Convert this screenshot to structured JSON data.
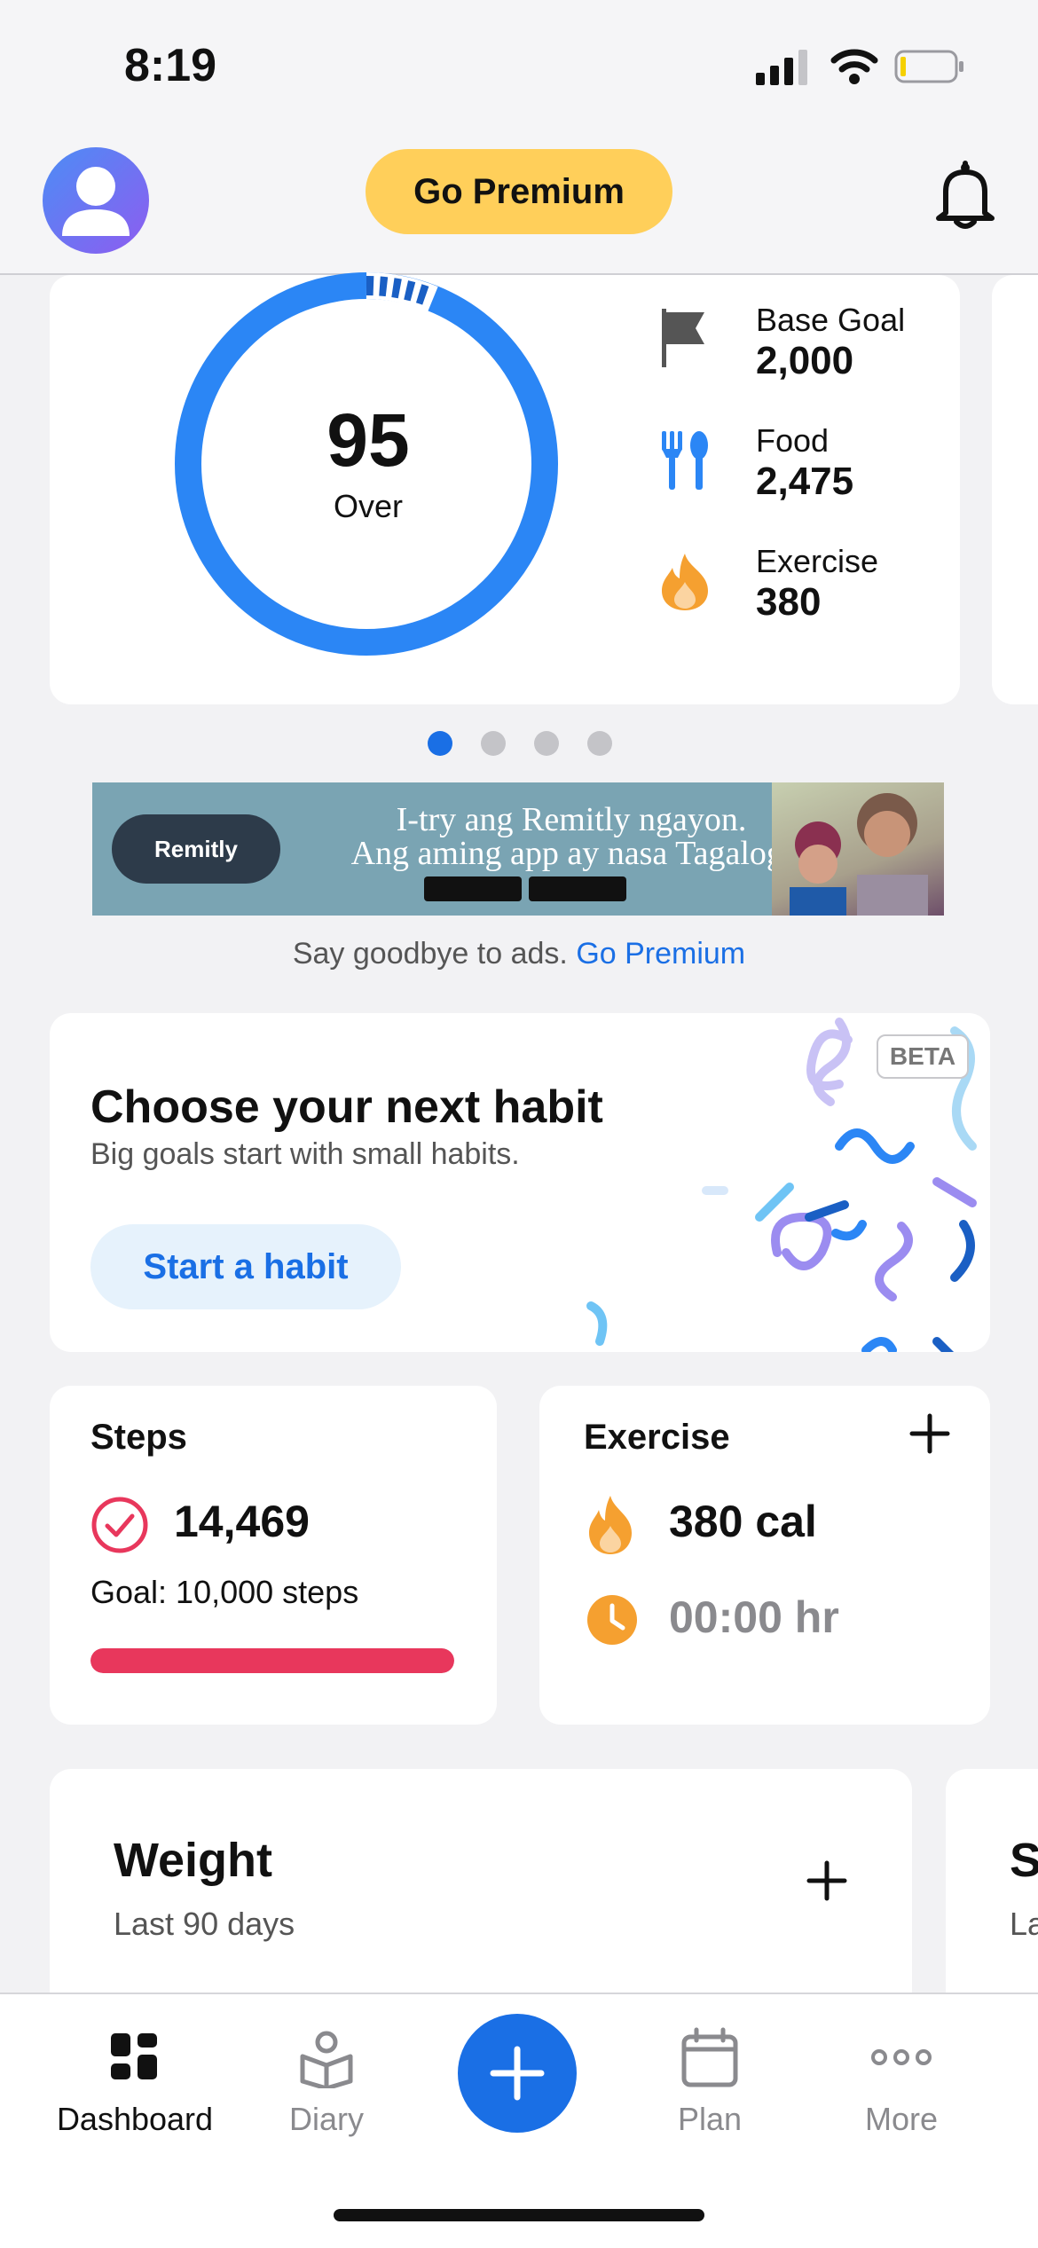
{
  "status_bar": {
    "time": "8:19"
  },
  "header": {
    "premium_label": "Go Premium"
  },
  "calories": {
    "remaining_value": "95",
    "remaining_label": "Over",
    "stats": [
      {
        "label": "Base Goal",
        "value": "2,000",
        "icon": "flag-icon"
      },
      {
        "label": "Food",
        "value": "2,475",
        "icon": "fork-knife-icon"
      },
      {
        "label": "Exercise",
        "value": "380",
        "icon": "flame-icon"
      }
    ],
    "ring_color": "#2b86f5"
  },
  "carousel": {
    "page_count": 4,
    "active_page": 1
  },
  "ad": {
    "brand": "Remitly",
    "line_1": "I-try ang Remitly ngayon.",
    "line_2": "Ang aming app ay nasa Tagalog.",
    "footer_text": "Say goodbye to ads.",
    "footer_link": "Go Premium"
  },
  "habit": {
    "badge": "BETA",
    "title": "Choose your next habit",
    "subtitle": "Big goals start with small habits.",
    "button": "Start a habit"
  },
  "steps": {
    "title": "Steps",
    "value": "14,469",
    "goal": "Goal: 10,000 steps",
    "progress": 1.0,
    "bar_color": "#e8375c"
  },
  "exercise": {
    "title": "Exercise",
    "calories": "380 cal",
    "duration": "00:00 hr",
    "accent_color": "#f5a030"
  },
  "weight": {
    "title": "Weight",
    "subtitle": "Last 90 days",
    "next_card_title": "S",
    "next_card_subtitle": "La"
  },
  "tabs": [
    {
      "label": "Dashboard",
      "icon": "dashboard-icon",
      "active": true
    },
    {
      "label": "Diary",
      "icon": "diary-icon",
      "active": false
    },
    {
      "label": "Plan",
      "icon": "calendar-icon",
      "active": false
    },
    {
      "label": "More",
      "icon": "more-icon",
      "active": false
    }
  ],
  "colors": {
    "accent": "#1a6fe5",
    "premium": "#ffcf5a"
  }
}
